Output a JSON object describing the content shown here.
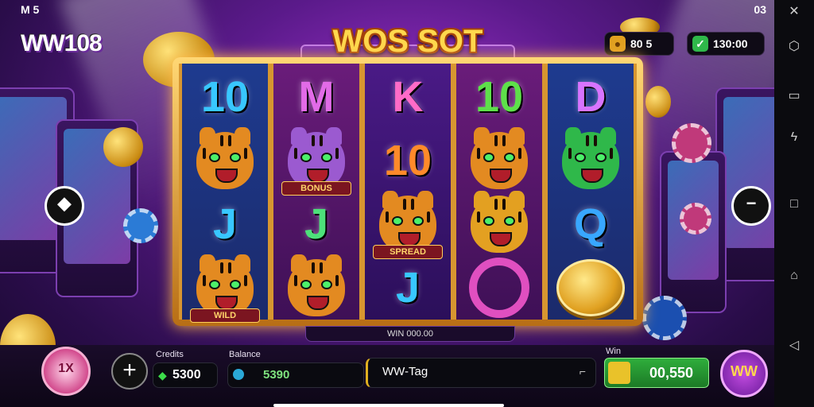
{
  "status": {
    "left_text": "M 5",
    "right_text": "03"
  },
  "logo": "WW108",
  "title": "WOS SOT",
  "top_pills": {
    "coins": {
      "icon": "coin-icon",
      "value": "80 5"
    },
    "balance": {
      "icon": "check-icon",
      "value": "130:00"
    }
  },
  "reels": [
    [
      {
        "type": "text",
        "value": "10",
        "color": "#38c7ff"
      },
      {
        "type": "tiger",
        "color": "#e38a21",
        "plaque": ""
      },
      {
        "type": "text",
        "value": "J",
        "color": "#38c7ff"
      },
      {
        "type": "tiger",
        "color": "#e38a21",
        "plaque": "WILD"
      }
    ],
    [
      {
        "type": "text",
        "value": "M",
        "color": "#e26be8"
      },
      {
        "type": "tiger",
        "color": "#9b5ad0",
        "plaque": "BONUS"
      },
      {
        "type": "text",
        "value": "J",
        "color": "#4de07a"
      },
      {
        "type": "tiger",
        "color": "#e38a21",
        "plaque": ""
      }
    ],
    [
      {
        "type": "text",
        "value": "K",
        "color": "#ff6bc8"
      },
      {
        "type": "text",
        "value": "10",
        "color": "#ff8a2a"
      },
      {
        "type": "tiger",
        "color": "#e38a21",
        "plaque": "SPREAD"
      },
      {
        "type": "text",
        "value": "J",
        "color": "#38c7ff"
      }
    ],
    [
      {
        "type": "text",
        "value": "10",
        "color": "#5ee04a"
      },
      {
        "type": "tiger",
        "color": "#e38a21",
        "plaque": ""
      },
      {
        "type": "tiger",
        "color": "#e3a021",
        "plaque": ""
      },
      {
        "type": "swirl",
        "color": "#e04fc0"
      }
    ],
    [
      {
        "type": "text",
        "value": "D",
        "color": "#d874ff"
      },
      {
        "type": "tiger",
        "color": "#2fb84a",
        "plaque": ""
      },
      {
        "type": "text",
        "value": "Q",
        "color": "#38a7ff"
      },
      {
        "type": "coin",
        "color": "#e0a020"
      }
    ]
  ],
  "lines_label": "WIN 000.00",
  "bottom": {
    "spin_badge": "1X",
    "credits_label": "Credits",
    "credits_value": "5300",
    "balance_label": "Balance",
    "balance_value": "5390",
    "message": "WW-Tag",
    "win_label": "Win",
    "win_value": "00,550",
    "menu_label": "WW"
  },
  "nav": {
    "icons": [
      "back-icon",
      "menu-icon",
      "share-icon",
      "square-icon",
      "home-icon",
      "triangle-icon"
    ]
  }
}
